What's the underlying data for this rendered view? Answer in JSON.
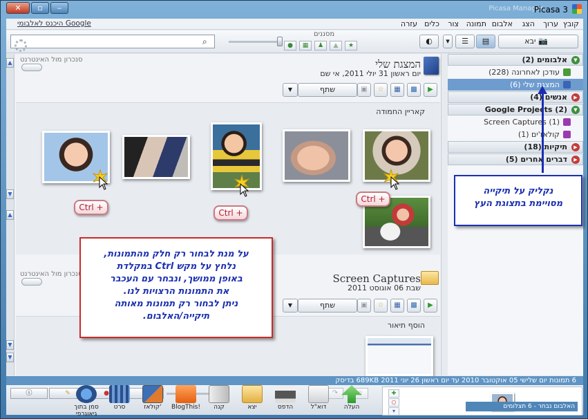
{
  "window": {
    "title": "Picasa 3",
    "close_glyph": "✕",
    "max_glyph": "▫",
    "min_glyph": "‒",
    "right_ghost_label": "Picasa Manager"
  },
  "menubar": {
    "items": [
      "קובץ",
      "ערוך",
      "הצג",
      "אלבום",
      "תמונה",
      "צור",
      "כלים",
      "עזרה"
    ],
    "signin": "היכנס לאלבומי Google"
  },
  "toolbar": {
    "import_label": "יבא",
    "filters_label": "מסננים",
    "search_placeholder": ""
  },
  "albums": [
    {
      "title": "המצגת שלי",
      "date": "יום ראשון 31 יולי 2011, אי שם",
      "sync_label": "סנכרון מול האינטרנט",
      "share_label": "שתף",
      "caption": "קאריין החמודה"
    },
    {
      "title": "Screen Captures",
      "date": "שבת 06 אוגוסט 2011",
      "sync_label": "סנכרון מול האינטרנט",
      "share_label": "שתף",
      "caption": "הוסף תיאור"
    }
  ],
  "ctrl_tag": "Ctrl +",
  "callout_left": [
    "על מנת לבחור רק חלק מהתמונות,",
    "נלחץ על מקש Ctrl במקלדת",
    "באופן ממושך, ונבחר עם העכבר",
    "את התמונות הרצויות לנו.",
    "ניתן לבחור רק תמונות מאותה",
    "תיקייה/האלבום."
  ],
  "callout_right": [
    "נקליק על תיקייה",
    "מסויימת בתצוגת העץ"
  ],
  "tree": {
    "groups": [
      {
        "label": "אלבומים (2)",
        "open": true
      },
      {
        "label": "אנשים (4)",
        "open": false
      },
      {
        "label": "Google Projects (2)",
        "open": true
      },
      {
        "label": "תיקיות (18)",
        "open": false
      },
      {
        "label": "דברים אחרים (5)",
        "open": false
      }
    ],
    "items": [
      {
        "label": "עודכן לאחרונה (228)",
        "selected": false
      },
      {
        "label": "המצגת שלי (6)",
        "selected": true
      },
      {
        "label": "Screen Captures (1)",
        "selected": false
      },
      {
        "label": "קולאז'ים (1)",
        "selected": false
      }
    ]
  },
  "status": {
    "text": "6 תמונות     יום שלישי 05 אוקטובר 2010 עד יום ראשון 26 יוני 2011     689KB בדיסק"
  },
  "tray": {
    "tools": [
      "העלה",
      "דוא\"ל",
      "הדפס",
      "יצא",
      "קנה",
      "BlogThis!",
      "קולאז'",
      "סרט",
      "סמן בתוך גיאוגרפי"
    ],
    "selection_label": "האלבום נבחר - 6 תצלומים"
  },
  "colors": {
    "accent": "#4f86b8",
    "callout_border_left": "#c82a2a",
    "callout_border_right": "#1a2fb0",
    "callout_text": "#1a2fb0",
    "tree_selected": "#6f9ccf"
  }
}
